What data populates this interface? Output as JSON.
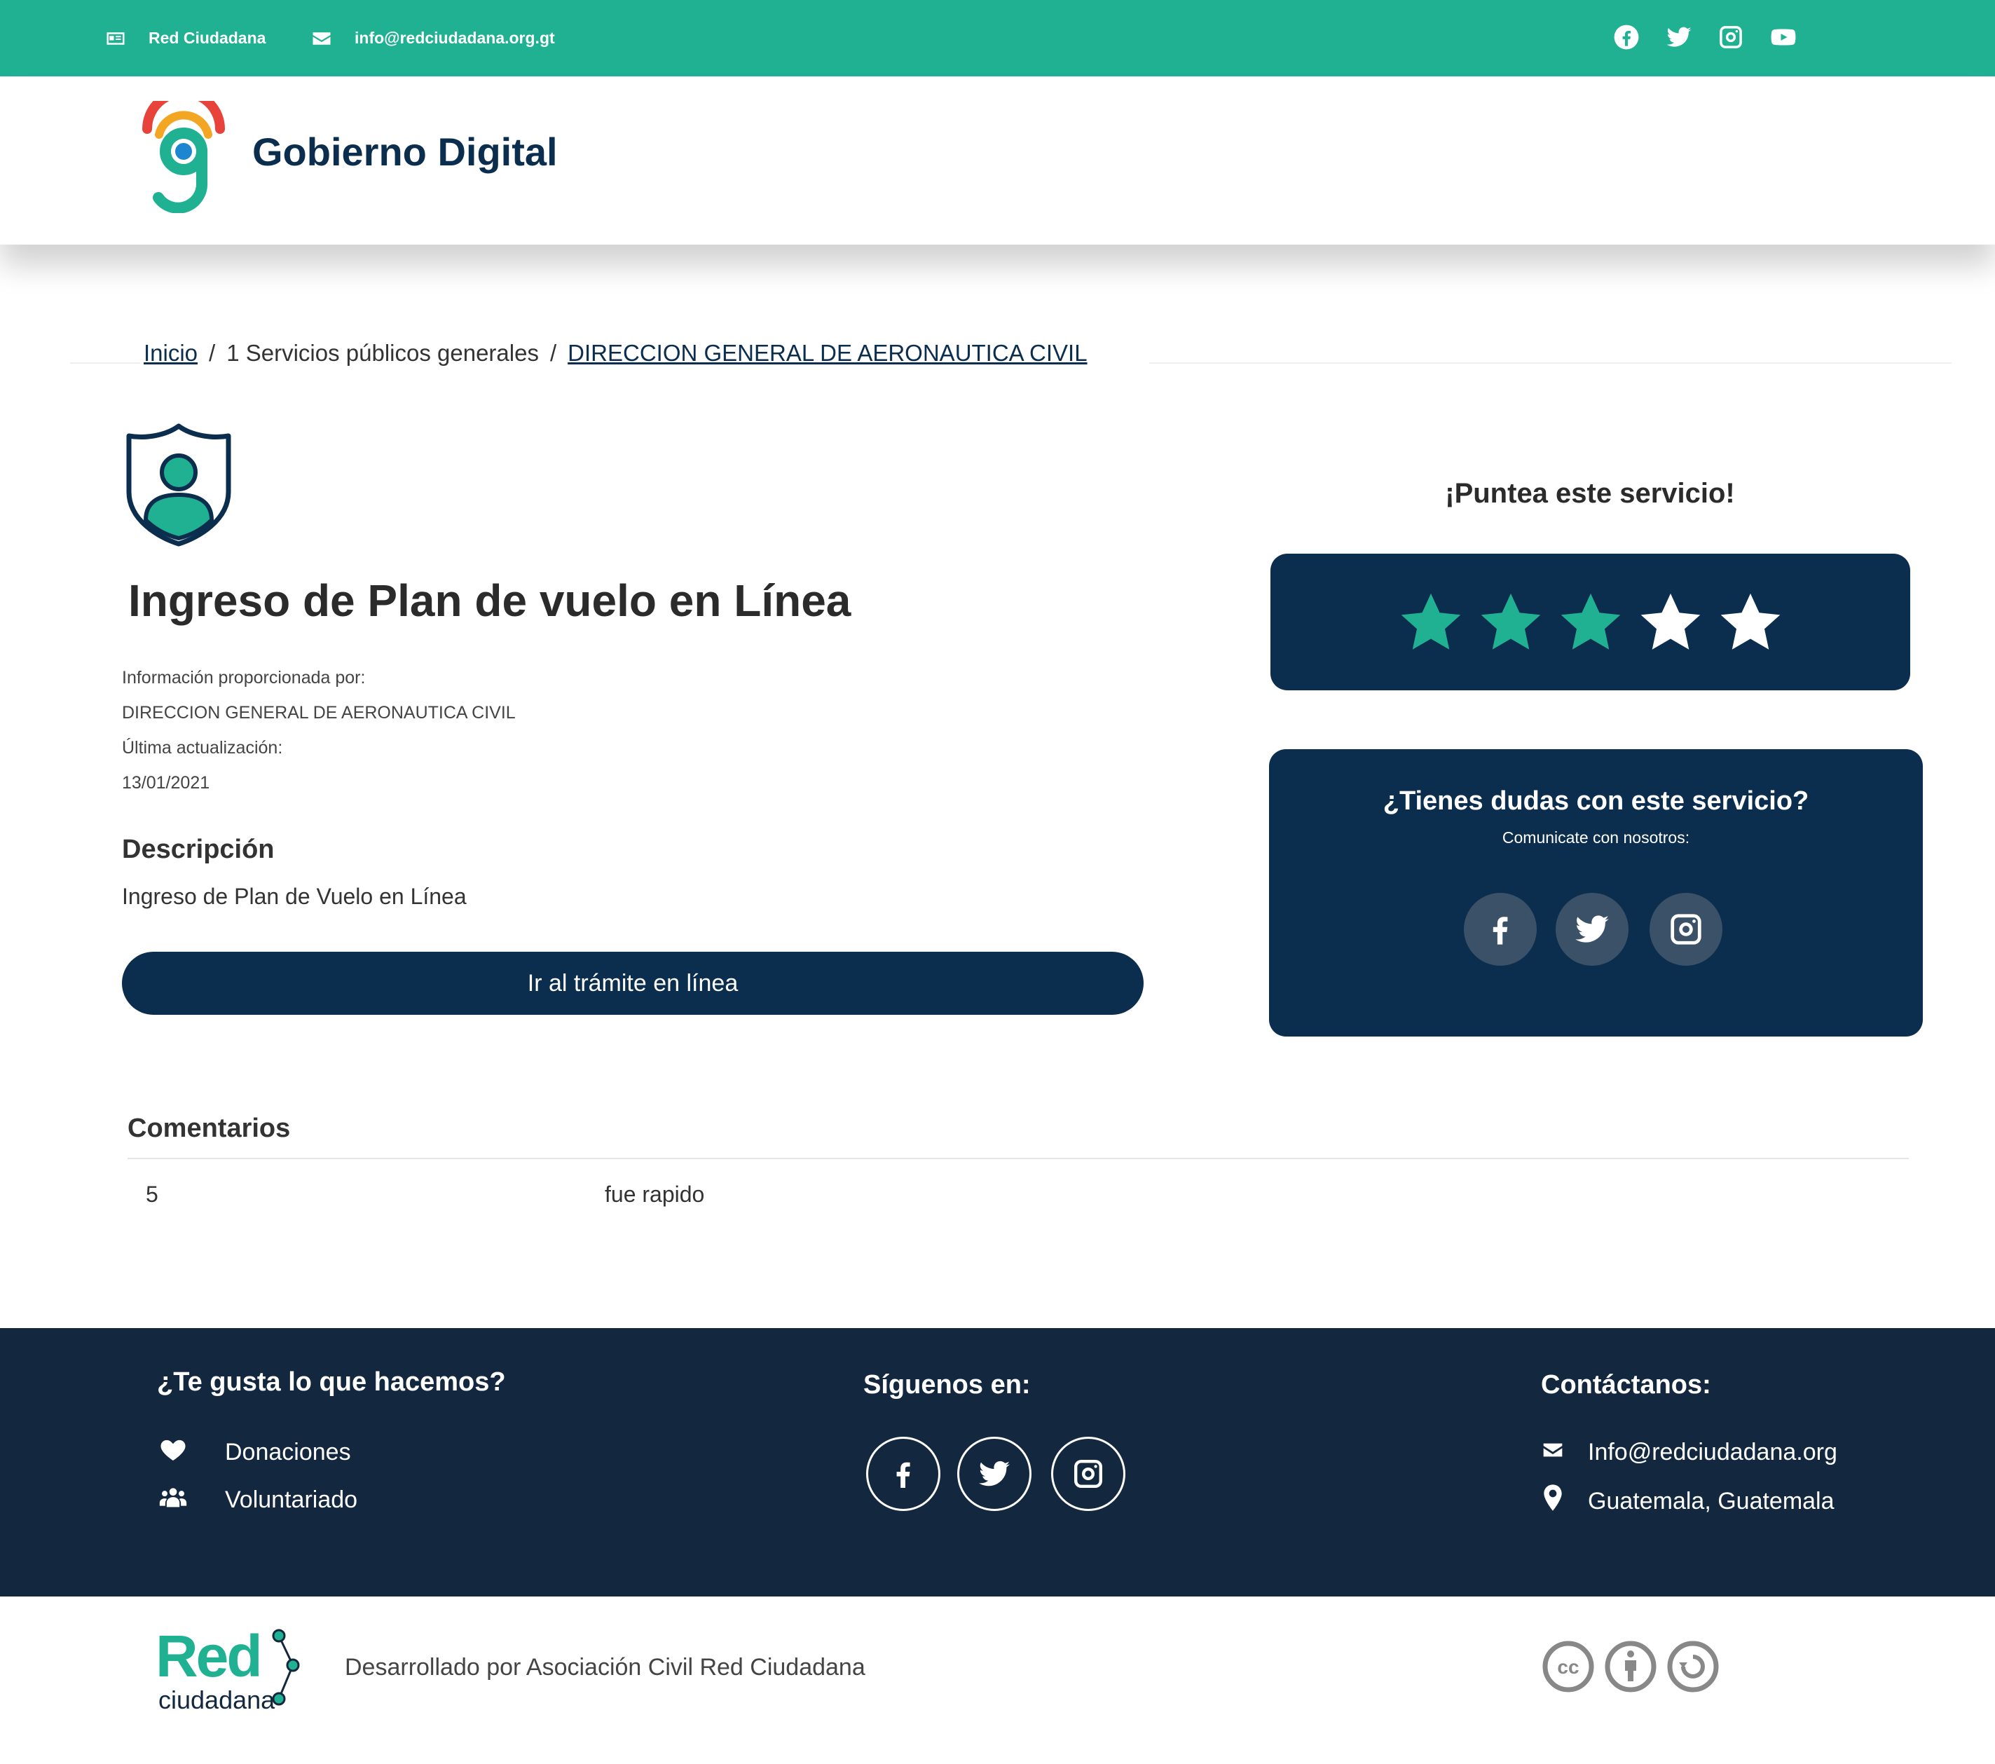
{
  "topbar": {
    "org_name": "Red Ciudadana",
    "email": "info@redciudadana.org.gt",
    "social": [
      "facebook-icon",
      "twitter-icon",
      "instagram-icon",
      "youtube-icon"
    ],
    "color": "#20b193"
  },
  "header": {
    "brand": "Gobierno Digital"
  },
  "breadcrumb": {
    "home": "Inicio",
    "category": "1 Servicios públicos generales",
    "institution": "DIRECCION GENERAL DE AERONAUTICA CIVIL",
    "separator": "/"
  },
  "service": {
    "title": "Ingreso de Plan de vuelo en Línea",
    "info_label": "Información proporcionada por:",
    "provider": "DIRECCION GENERAL DE AERONAUTICA CIVIL",
    "updated_label": "Última actualización:",
    "updated_date": "13/01/2021",
    "description_heading": "Descripción",
    "description": "Ingreso de Plan de Vuelo en Línea",
    "cta_label": "Ir al trámite en línea"
  },
  "rating": {
    "title": "¡Puntea este servicio!",
    "max": 5,
    "value": 3,
    "filled_color": "#20b193",
    "empty_color": "#ffffff"
  },
  "help": {
    "title": "¿Tienes dudas con este servicio?",
    "subtitle": "Comunicate con nosotros:",
    "social": [
      "facebook-icon",
      "twitter-icon",
      "instagram-icon"
    ]
  },
  "comments": {
    "heading": "Comentarios",
    "items": [
      {
        "rating": "5",
        "text": "fue rapido"
      }
    ]
  },
  "footer": {
    "like_heading": "¿Te gusta lo que hacemos?",
    "donations": "Donaciones",
    "volunteering": "Voluntariado",
    "follow_heading": "Síguenos en:",
    "contact_heading": "Contáctanos:",
    "email": "Info@redciudadana.org",
    "location": "Guatemala, Guatemala",
    "background": "#13283f"
  },
  "bottom": {
    "logo_word": "Red",
    "logo_sub": "ciudadana",
    "developed_by": "Desarrollado por Asociación Civil Red Ciudadana",
    "license_icons": [
      "cc-icon",
      "attribution-icon",
      "share-alike-icon"
    ]
  }
}
